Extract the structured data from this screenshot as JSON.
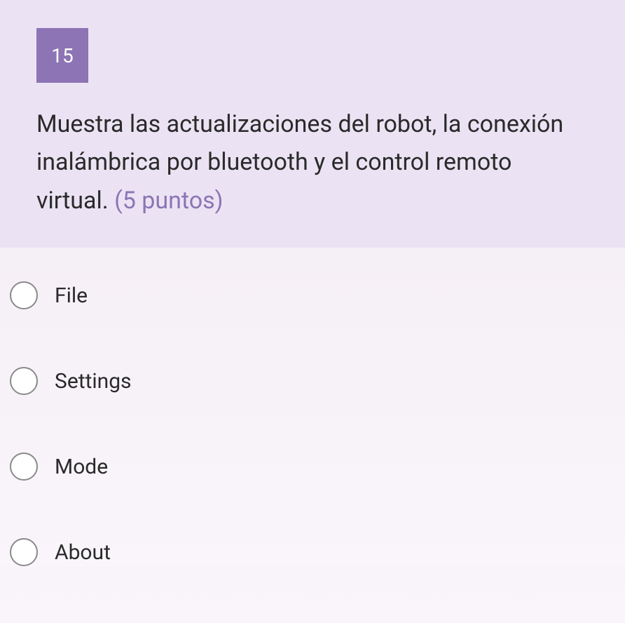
{
  "question": {
    "number": "15",
    "text": "Muestra las actualizaciones del robot, la conexión inalámbrica por bluetooth y el control remoto virtual. ",
    "points": "(5 puntos)"
  },
  "options": [
    {
      "label": "File"
    },
    {
      "label": "Settings"
    },
    {
      "label": "Mode"
    },
    {
      "label": "About"
    }
  ]
}
